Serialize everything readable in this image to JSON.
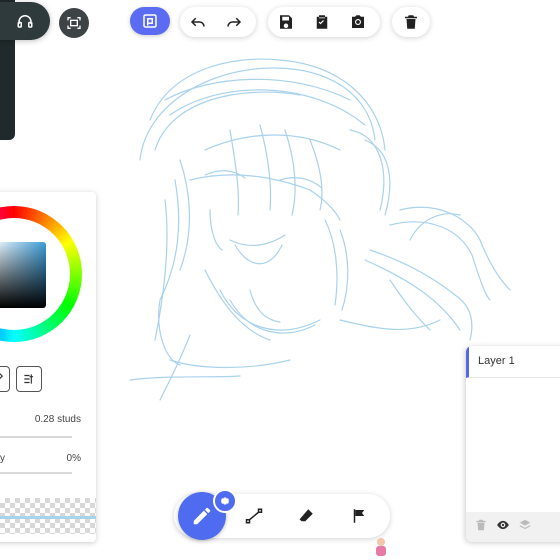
{
  "canvas": {
    "sketch_stroke_color": "#a9d2ec",
    "background": "#ffffff"
  },
  "toolbar": {
    "accent_color": "#5b6cf2",
    "buttons": [
      "app-logo-icon",
      "undo-icon",
      "redo-icon",
      "save-icon",
      "clipboard-icon",
      "camera-icon",
      "trash-icon"
    ]
  },
  "color_panel": {
    "brush_size_value": "0.28 studs",
    "opacity_label": "y",
    "opacity_value": "0%"
  },
  "layers": {
    "items": [
      {
        "name": "Layer 1"
      }
    ],
    "footer_icons": [
      "trash-icon",
      "eye-icon",
      "layers-icon"
    ]
  },
  "bottom_tools": {
    "active_color": "#4f6cf0",
    "tools": [
      "pencil-icon",
      "line-icon",
      "eraser-icon",
      "flag-icon"
    ]
  }
}
